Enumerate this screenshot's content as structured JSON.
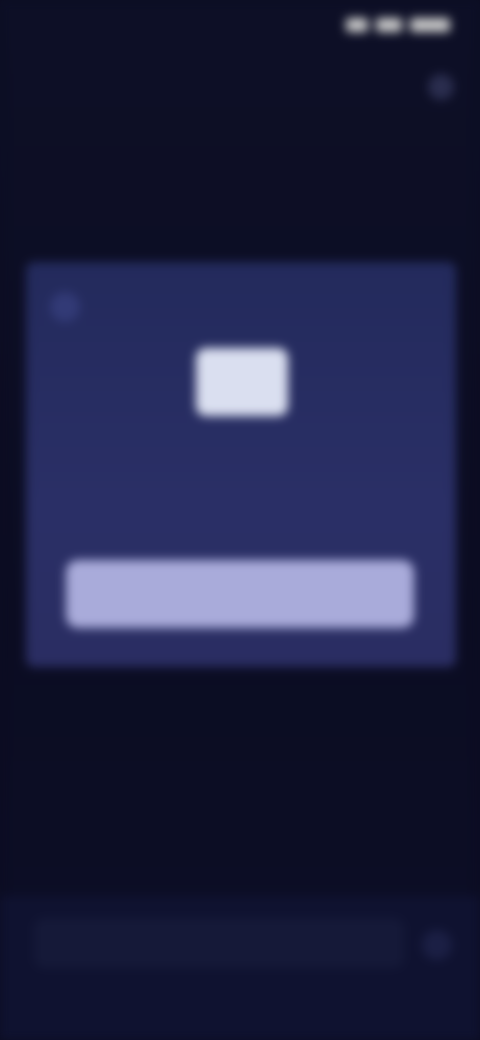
{
  "status_bar": {
    "time": "",
    "icons": [
      "signal-icon",
      "wifi-icon",
      "battery-icon"
    ]
  },
  "header": {
    "title": "",
    "subtitle": ""
  },
  "card": {
    "caption": "",
    "note": "",
    "button_label": ""
  },
  "composer": {
    "placeholder": ""
  },
  "colors": {
    "background": "#0c0d22",
    "card": "#262c62",
    "button": "#a9abda",
    "status_time": "#b9b48c"
  }
}
